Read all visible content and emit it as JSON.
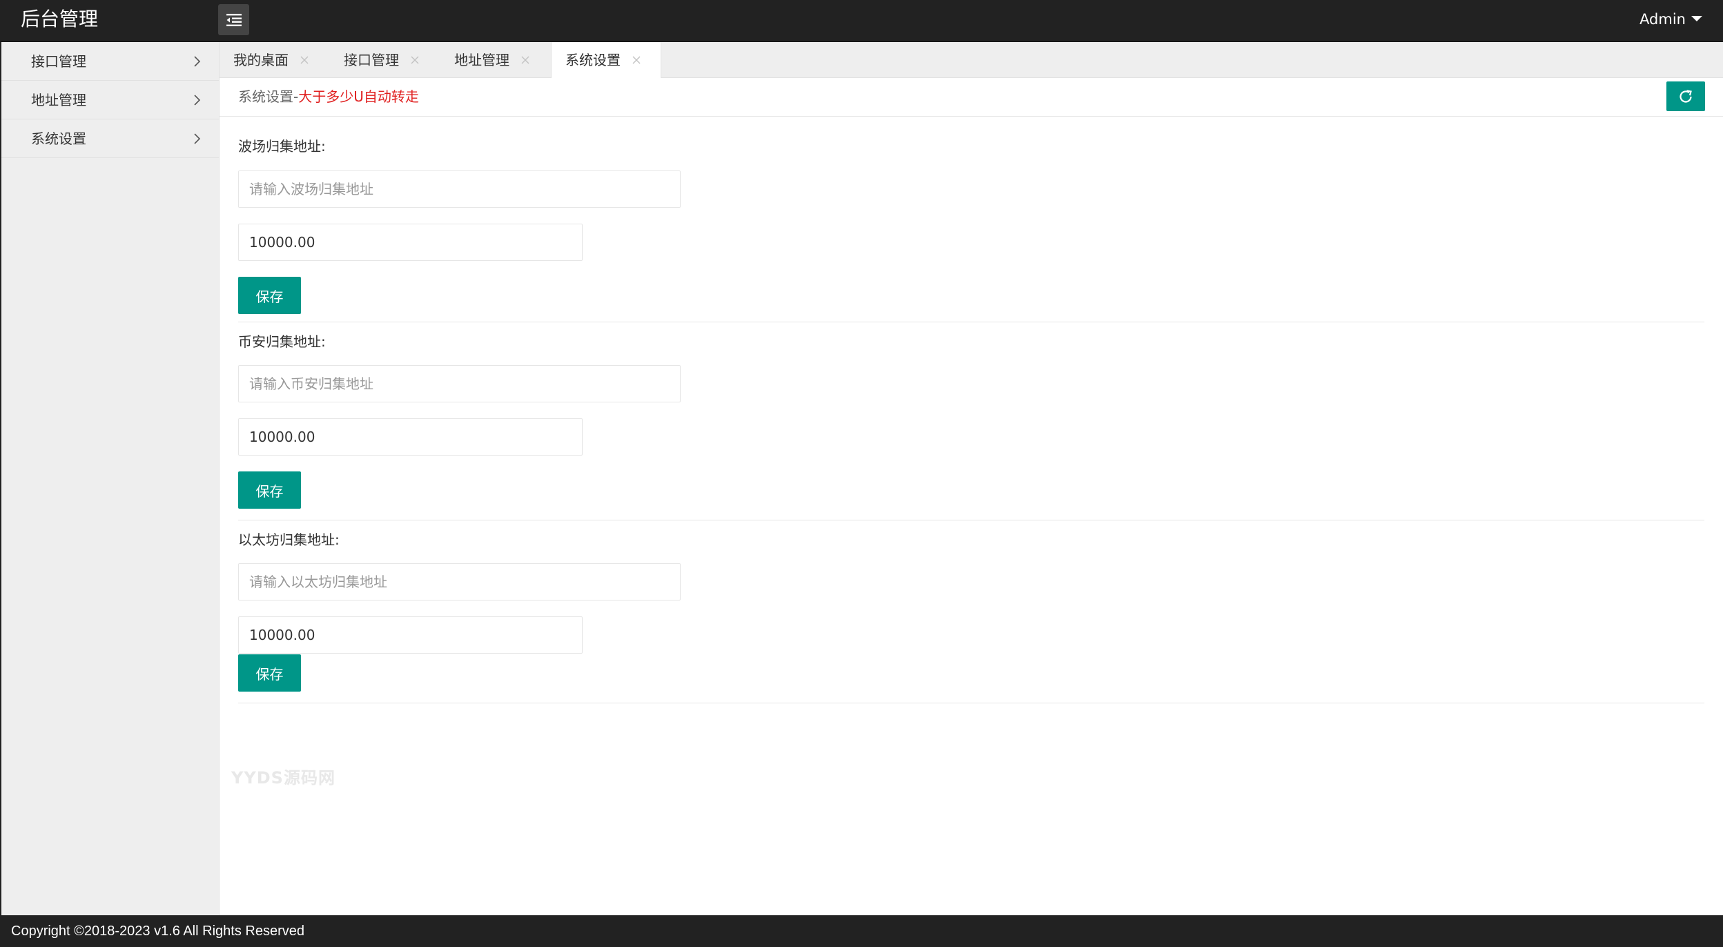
{
  "header": {
    "title": "后台管理",
    "user": "Admin"
  },
  "sidebar": {
    "items": [
      {
        "label": "接口管理"
      },
      {
        "label": "地址管理"
      },
      {
        "label": "系统设置"
      }
    ]
  },
  "tabs": [
    {
      "label": "我的桌面"
    },
    {
      "label": "接口管理"
    },
    {
      "label": "地址管理"
    },
    {
      "label": "系统设置",
      "active": true
    }
  ],
  "breadcrumb": {
    "prefix": "系统设置-",
    "highlight": "大于多少U自动转走"
  },
  "sections": [
    {
      "label": "波场归集地址:",
      "placeholder": "请输入波场归集地址",
      "amount": "10000.00",
      "save_label": "保存"
    },
    {
      "label": "币安归集地址:",
      "placeholder": "请输入币安归集地址",
      "amount": "10000.00",
      "save_label": "保存"
    },
    {
      "label": "以太坊归集地址:",
      "placeholder": "请输入以太坊归集地址",
      "amount": "10000.00",
      "save_label": "保存"
    }
  ],
  "watermark": "YYDS源码网",
  "footer": {
    "copyright": "Copyright ©2018-2023 v1.6 All Rights Reserved"
  },
  "colors": {
    "header_bg": "#222222",
    "accent": "#009688",
    "highlight_text": "#e02020",
    "sidebar_bg": "#eeeeee"
  },
  "icons": {
    "menu_toggle": "indent-menu-icon",
    "refresh": "refresh-icon",
    "tab_close": "close-icon",
    "sidebar_arrow": "chevron-right-icon",
    "user_menu": "caret-down-icon"
  }
}
